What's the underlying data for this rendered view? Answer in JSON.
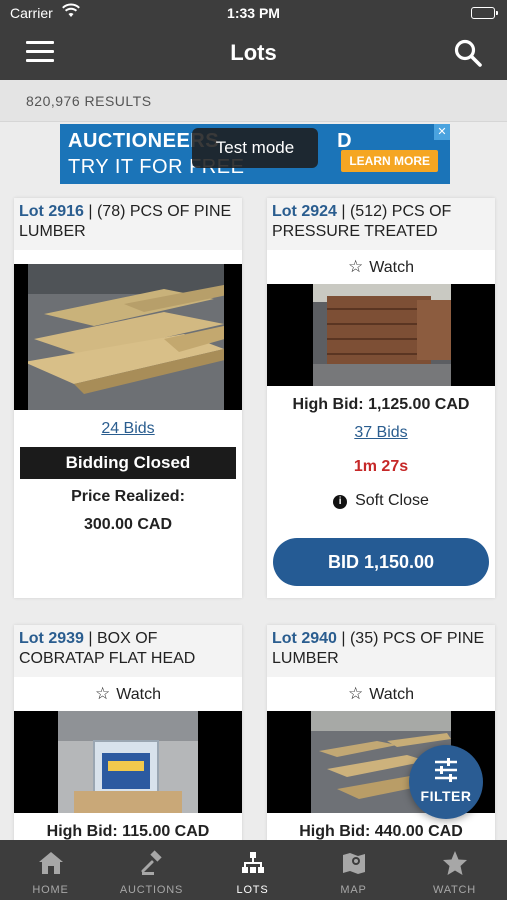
{
  "status": {
    "carrier": "Carrier",
    "time": "1:33 PM"
  },
  "nav": {
    "title": "Lots"
  },
  "results": {
    "count": "820,976 RESULTS"
  },
  "ad": {
    "line1": "AUCTIONEERS",
    "line1_tail": "D",
    "line2": "TRY IT FOR FREE",
    "cta": "LEARN MORE",
    "overlay": "Test mode"
  },
  "lots": [
    {
      "lot": "Lot 2916",
      "sep": " | ",
      "desc": "(78) PCS OF PINE LUMBER",
      "bids": "24 Bids",
      "status": "Bidding Closed",
      "price_label": "Price Realized:",
      "price": "300.00 CAD"
    },
    {
      "lot": "Lot 2924",
      "sep": " | ",
      "desc": "(512) PCS OF PRESSURE TREATED",
      "watch": "Watch",
      "high_bid": "High Bid: 1,125.00 CAD",
      "bids": "37 Bids",
      "timer": "1m  27s",
      "soft_close": "Soft Close",
      "bid_button": "BID 1,150.00"
    },
    {
      "lot": "Lot 2939",
      "sep": " | ",
      "desc": "BOX OF COBRATAP FLAT HEAD",
      "watch": "Watch",
      "high_bid": "High Bid: 115.00 CAD"
    },
    {
      "lot": "Lot 2940",
      "sep": " | ",
      "desc": "(35) PCS OF PINE LUMBER",
      "watch": "Watch",
      "high_bid": "High Bid: 440.00 CAD"
    }
  ],
  "filter": {
    "label": "FILTER"
  },
  "tabs": [
    {
      "label": "HOME",
      "icon": "home-icon"
    },
    {
      "label": "AUCTIONS",
      "icon": "gavel-icon"
    },
    {
      "label": "LOTS",
      "icon": "lots-icon"
    },
    {
      "label": "MAP",
      "icon": "map-icon"
    },
    {
      "label": "WATCH",
      "icon": "star-icon"
    }
  ],
  "colors": {
    "bar": "#3d3d3d",
    "link": "#2a5d8f",
    "button": "#255b94",
    "timer": "#c62828",
    "ad": "#1b74b8"
  }
}
